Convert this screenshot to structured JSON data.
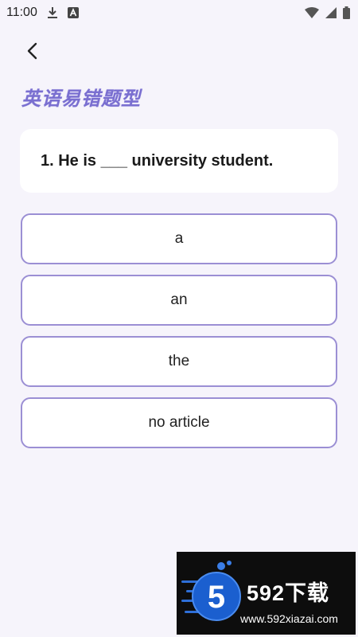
{
  "status_bar": {
    "time": "11:00",
    "icons": [
      "download-icon",
      "font-a-icon",
      "wifi-icon",
      "signal-icon",
      "battery-icon"
    ]
  },
  "nav": {
    "back_icon": "chevron-left-icon"
  },
  "page": {
    "title": "英语易错题型"
  },
  "question": {
    "text": "1. He is ___ university student."
  },
  "options": [
    {
      "label": "a"
    },
    {
      "label": "an"
    },
    {
      "label": "the"
    },
    {
      "label": "no article"
    }
  ],
  "watermark": {
    "logo_glyph": "5",
    "brand": "592下载",
    "url": "www.592xiazai.com"
  },
  "colors": {
    "background": "#f6f4fb",
    "accent": "#7a6fd0",
    "option_border": "#9b8fd4",
    "card": "#ffffff"
  }
}
